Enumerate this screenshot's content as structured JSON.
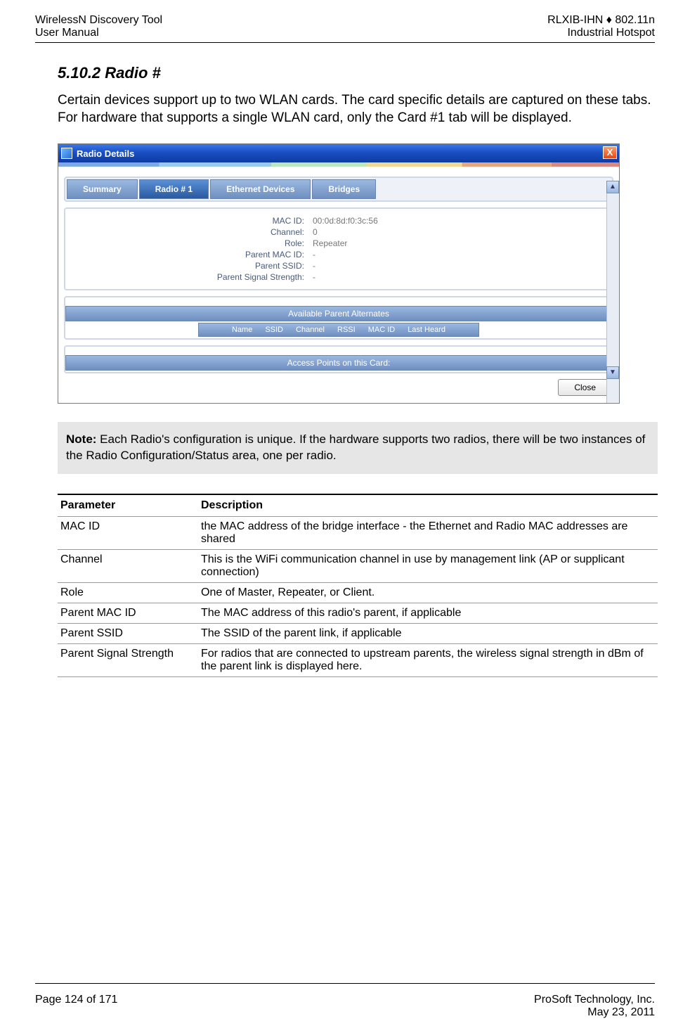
{
  "header": {
    "left_line1": "WirelessN Discovery Tool",
    "left_line2": "User Manual",
    "right_line1": "RLXIB-IHN ♦ 802.11n",
    "right_line2": "Industrial Hotspot"
  },
  "section": {
    "heading": "5.10.2 Radio #",
    "para": "Certain devices support up to two WLAN cards. The card specific details are captured on these tabs. For hardware that supports a single WLAN card, only the Card #1 tab will be displayed."
  },
  "dialog": {
    "title": "Radio Details",
    "close_x": "X",
    "tabs": [
      "Summary",
      "Radio # 1",
      "Ethernet Devices",
      "Bridges"
    ],
    "selected_tab_index": 1,
    "fields": {
      "mac_id_label": "MAC ID:",
      "mac_id_value": "00:0d:8d:f0:3c:56",
      "channel_label": "Channel:",
      "channel_value": "0",
      "role_label": "Role:",
      "role_value": "Repeater",
      "parent_mac_label": "Parent MAC ID:",
      "parent_mac_value": "-",
      "parent_ssid_label": "Parent SSID:",
      "parent_ssid_value": "-",
      "parent_signal_label": "Parent Signal Strength:",
      "parent_signal_value": "-"
    },
    "section1_title": "Available Parent Alternates",
    "section1_cols": [
      "Name",
      "SSID",
      "Channel",
      "RSSI",
      "MAC ID",
      "Last Heard"
    ],
    "section2_title": "Access Points on this Card:",
    "close_button": "Close"
  },
  "note": {
    "label": "Note:",
    "text": " Each Radio's configuration is unique. If the hardware supports two radios, there will be two instances of the Radio Configuration/Status area, one per radio."
  },
  "param_table": {
    "head_param": "Parameter",
    "head_desc": "Description",
    "rows": [
      {
        "p": "MAC ID",
        "d": "the MAC address of the bridge interface - the Ethernet and Radio MAC addresses are shared"
      },
      {
        "p": "Channel",
        "d": "This is the WiFi communication channel in use by management link (AP or supplicant connection)"
      },
      {
        "p": "Role",
        "d": "One of Master, Repeater, or Client."
      },
      {
        "p": "Parent MAC ID",
        "d": "The MAC address of this radio's parent, if applicable"
      },
      {
        "p": "Parent SSID",
        "d": "The SSID of the parent link, if applicable"
      },
      {
        "p": "Parent Signal Strength",
        "d": "For radios that are connected to upstream parents, the wireless signal strength in dBm of the parent link is displayed here."
      }
    ]
  },
  "footer": {
    "left": "Page 124 of 171",
    "right_line1": "ProSoft Technology, Inc.",
    "right_line2": "May 23, 2011"
  }
}
